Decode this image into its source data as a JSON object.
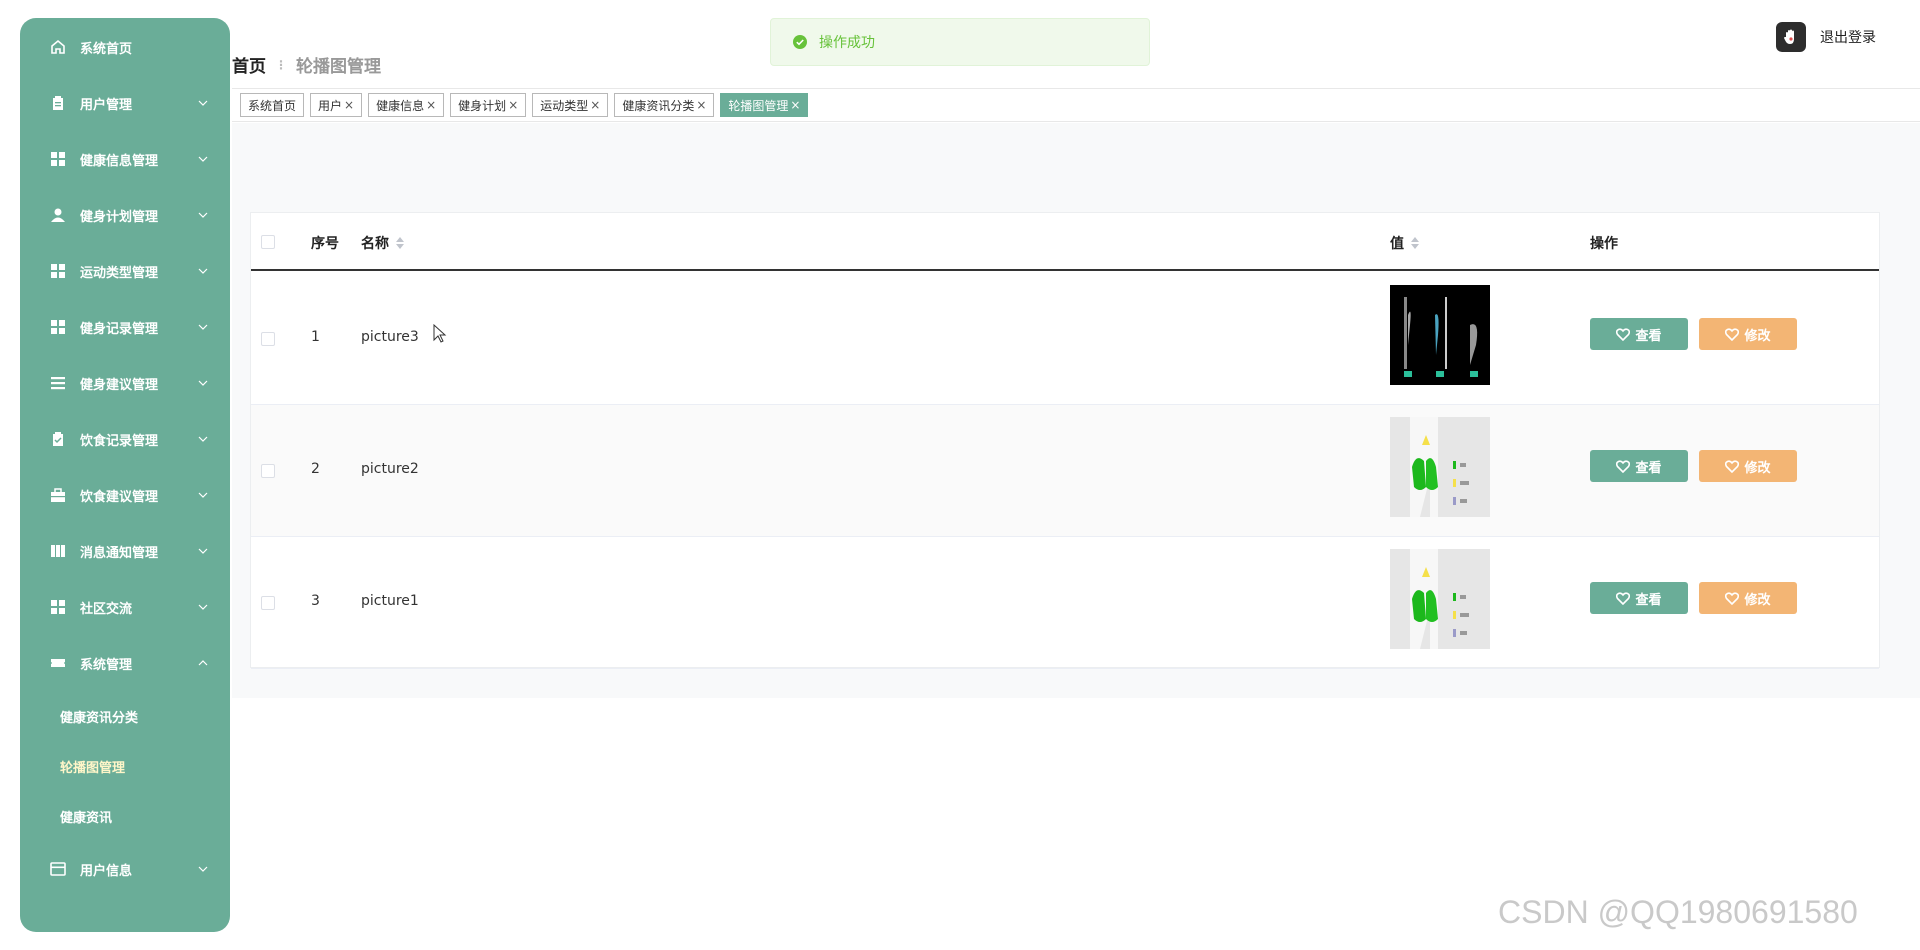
{
  "sidebar": {
    "items": [
      {
        "label": "系统首页",
        "icon": "home-icon",
        "chevron": ""
      },
      {
        "label": "用户管理",
        "icon": "clipboard-icon",
        "chevron": "down"
      },
      {
        "label": "健康信息管理",
        "icon": "grid-icon",
        "chevron": "down"
      },
      {
        "label": "健身计划管理",
        "icon": "user-icon",
        "chevron": "down"
      },
      {
        "label": "运动类型管理",
        "icon": "grid-icon",
        "chevron": "down"
      },
      {
        "label": "健身记录管理",
        "icon": "grid-icon",
        "chevron": "down"
      },
      {
        "label": "健身建议管理",
        "icon": "list-icon",
        "chevron": "down"
      },
      {
        "label": "饮食记录管理",
        "icon": "clipboard-check-icon",
        "chevron": "down"
      },
      {
        "label": "饮食建议管理",
        "icon": "briefcase-icon",
        "chevron": "down"
      },
      {
        "label": "消息通知管理",
        "icon": "columns-icon",
        "chevron": "down"
      },
      {
        "label": "社区交流",
        "icon": "grid-icon",
        "chevron": "down"
      },
      {
        "label": "系统管理",
        "icon": "ticket-icon",
        "chevron": "up"
      }
    ],
    "sub_items": [
      {
        "label": "健康资讯分类",
        "active": false
      },
      {
        "label": "轮播图管理",
        "active": true
      },
      {
        "label": "健康资讯",
        "active": false
      }
    ],
    "last_item": {
      "label": "用户信息",
      "icon": "card-icon",
      "chevron": "down"
    }
  },
  "breadcrumb": {
    "home": "首页",
    "current": "轮播图管理"
  },
  "toast": {
    "message": "操作成功"
  },
  "header": {
    "logout_label": "退出登录"
  },
  "tabs": [
    {
      "label": "系统首页",
      "closable": false,
      "active": false
    },
    {
      "label": "用户",
      "closable": true,
      "active": false
    },
    {
      "label": "健康信息",
      "closable": true,
      "active": false
    },
    {
      "label": "健身计划",
      "closable": true,
      "active": false
    },
    {
      "label": "运动类型",
      "closable": true,
      "active": false
    },
    {
      "label": "健康资讯分类",
      "closable": true,
      "active": false
    },
    {
      "label": "轮播图管理",
      "closable": true,
      "active": true
    }
  ],
  "tab_close_glyph": "×",
  "table": {
    "columns": {
      "index": "序号",
      "name": "名称",
      "value": "值",
      "actions": "操作"
    },
    "rows": [
      {
        "index": "1",
        "name": "picture3",
        "image": "dark-anatomy-image"
      },
      {
        "index": "2",
        "name": "picture2",
        "image": "lung-diagram-image"
      },
      {
        "index": "3",
        "name": "picture1",
        "image": "lung-diagram-image"
      }
    ],
    "view_label": "查看",
    "edit_label": "修改"
  },
  "watermark": "CSDN @QQ1980691580",
  "colors": {
    "sidebar": "#6aad98",
    "view_button": "#6aad98",
    "edit_button": "#f3b574",
    "toast_text": "#67c23a"
  }
}
